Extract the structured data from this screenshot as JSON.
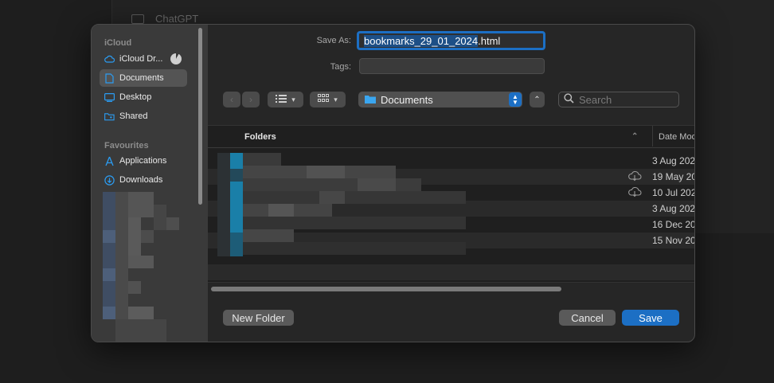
{
  "background": {
    "item_label": "ChatGPT"
  },
  "sidebar": {
    "sections": [
      {
        "title": "iCloud",
        "items": [
          {
            "label": "iCloud Dr...",
            "icon": "cloud-icon"
          },
          {
            "label": "Documents",
            "icon": "document-icon",
            "selected": true
          },
          {
            "label": "Desktop",
            "icon": "desktop-icon"
          },
          {
            "label": "Shared",
            "icon": "shared-folder-icon"
          }
        ]
      },
      {
        "title": "Favourites",
        "items": [
          {
            "label": "Applications",
            "icon": "applications-icon"
          },
          {
            "label": "Downloads",
            "icon": "downloads-icon"
          }
        ]
      }
    ]
  },
  "save_as": {
    "label": "Save As:",
    "filename_selected": "bookmarks_29_01_2024",
    "filename_ext": ".html"
  },
  "tags": {
    "label": "Tags:",
    "value": ""
  },
  "toolbar": {
    "location": "Documents",
    "search_placeholder": "Search"
  },
  "list": {
    "columns": {
      "name": "Folders",
      "date": "Date Modi"
    },
    "rows": [
      {
        "date": "3 Aug 202",
        "cloud": false
      },
      {
        "date": "19 May 20",
        "cloud": true
      },
      {
        "date": "10 Jul 202",
        "cloud": true
      },
      {
        "date": "3 Aug 202",
        "cloud": false
      },
      {
        "date": "16 Dec 20",
        "cloud": false
      },
      {
        "date": "15 Nov 20",
        "cloud": false
      }
    ]
  },
  "footer": {
    "new_folder": "New Folder",
    "cancel": "Cancel",
    "save": "Save"
  },
  "colors": {
    "accent": "#1c6fc4",
    "selection": "#1d4f86",
    "pixelated_teal": "#1a7fa8"
  }
}
